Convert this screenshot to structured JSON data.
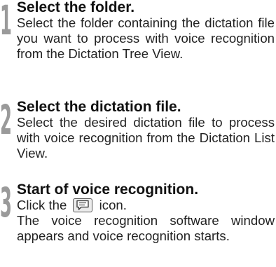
{
  "steps": [
    {
      "number": "1",
      "title": "Select the folder.",
      "text": "Select the folder containing the dictation file you want to process with voice recognition from the Dictation Tree View."
    },
    {
      "number": "2",
      "title": "Select the dictation file.",
      "text": "Select the desired dictation file to process with voice recognition from the Dictation List View."
    },
    {
      "number": "3",
      "title": "Start of voice recognition.",
      "click_before": "Click the",
      "click_after": "icon.",
      "icon": "voice-recognition-icon",
      "text": "The voice recognition software window appears and voice recognition starts."
    }
  ]
}
